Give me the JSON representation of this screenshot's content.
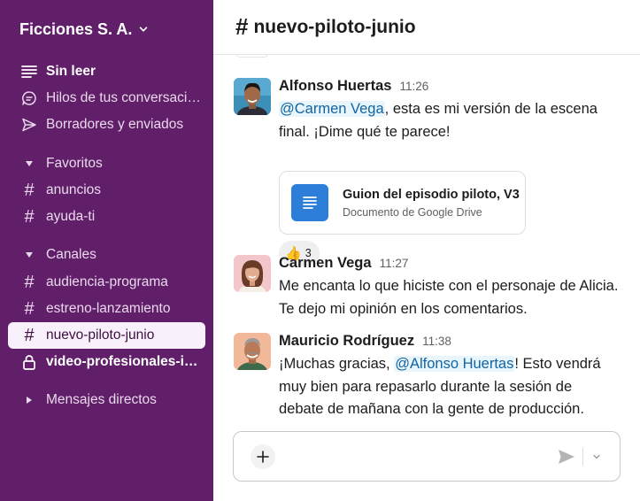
{
  "workspace": {
    "name": "Ficciones S. A."
  },
  "sidebar": {
    "items": [
      {
        "label": "Sin leer",
        "icon": "unread-icon"
      },
      {
        "label": "Hilos de tus conversacio...",
        "icon": "threads-icon"
      },
      {
        "label": "Borradores y enviados",
        "icon": "send-icon"
      }
    ],
    "sections": {
      "favorites": {
        "label": "Favoritos",
        "channels": [
          "anuncios",
          "ayuda-ti"
        ]
      },
      "channels": {
        "label": "Canales",
        "items": [
          {
            "name": "audiencia-programa"
          },
          {
            "name": "estreno-lanzamiento"
          },
          {
            "name": "nuevo-piloto-junio",
            "active": true
          },
          {
            "name": "video-profesionales-ind...",
            "private": true,
            "unread": true
          }
        ]
      },
      "direct_messages": {
        "label": "Mensajes directos"
      }
    }
  },
  "channel": {
    "hash": "#",
    "name": "nuevo-piloto-junio"
  },
  "messages": [
    {
      "author": "Alfonso Huertas",
      "time": "11:26",
      "mention": "@Carmen Vega",
      "text_after_mention": ", esta es mi versión de la escena final. ¡Dime qué te parece!",
      "attachment": {
        "title": "Guion del episodio piloto, V3",
        "subtitle": "Documento de Google Drive"
      },
      "reaction": {
        "emoji": "👍",
        "count": "3"
      }
    },
    {
      "author": "Carmen Vega",
      "time": "11:27",
      "text": "Me encanta lo que hiciste con el personaje de Alicia. Te dejo mi opinión en los comentarios."
    },
    {
      "author": "Mauricio Rodríguez",
      "time": "11:38",
      "text_before_mention": "¡Muchas gracias, ",
      "mention": "@Alfonso Huertas",
      "text_after_mention": "! Esto vendrá muy bien para repasarlo durante la sesión de debate de mañana con la gente de producción."
    }
  ],
  "composer": {
    "placeholder": ""
  },
  "colors": {
    "sidebar_bg": "#611f69",
    "active_item_bg": "#f8f0fb",
    "mention_bg": "#e8f5fa",
    "mention_text": "#1264a3",
    "doc_blue": "#2d7ed9"
  }
}
